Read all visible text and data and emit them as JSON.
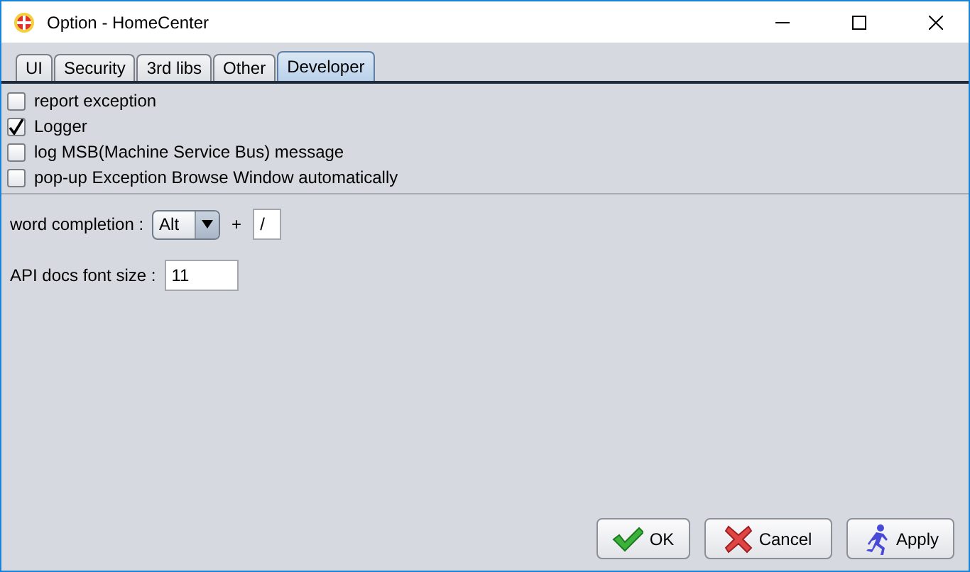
{
  "window": {
    "title": "Option - HomeCenter"
  },
  "tabs": [
    {
      "label": "UI",
      "selected": false
    },
    {
      "label": "Security",
      "selected": false
    },
    {
      "label": "3rd libs",
      "selected": false
    },
    {
      "label": "Other",
      "selected": false
    },
    {
      "label": "Developer",
      "selected": true
    }
  ],
  "options": [
    {
      "label": "report exception",
      "checked": false
    },
    {
      "label": "Logger",
      "checked": true
    },
    {
      "label": "log MSB(Machine Service Bus) message",
      "checked": false
    },
    {
      "label": "pop-up Exception Browse Window automatically",
      "checked": false
    }
  ],
  "word_completion": {
    "label": "word completion :",
    "modifier": "Alt",
    "plus": "+",
    "key": "/"
  },
  "api_font_size": {
    "label": "API docs font size :",
    "value": "11"
  },
  "buttons": [
    {
      "kind": "ok",
      "label": "OK"
    },
    {
      "kind": "cancel",
      "label": "Cancel"
    },
    {
      "kind": "apply",
      "label": "Apply"
    }
  ]
}
